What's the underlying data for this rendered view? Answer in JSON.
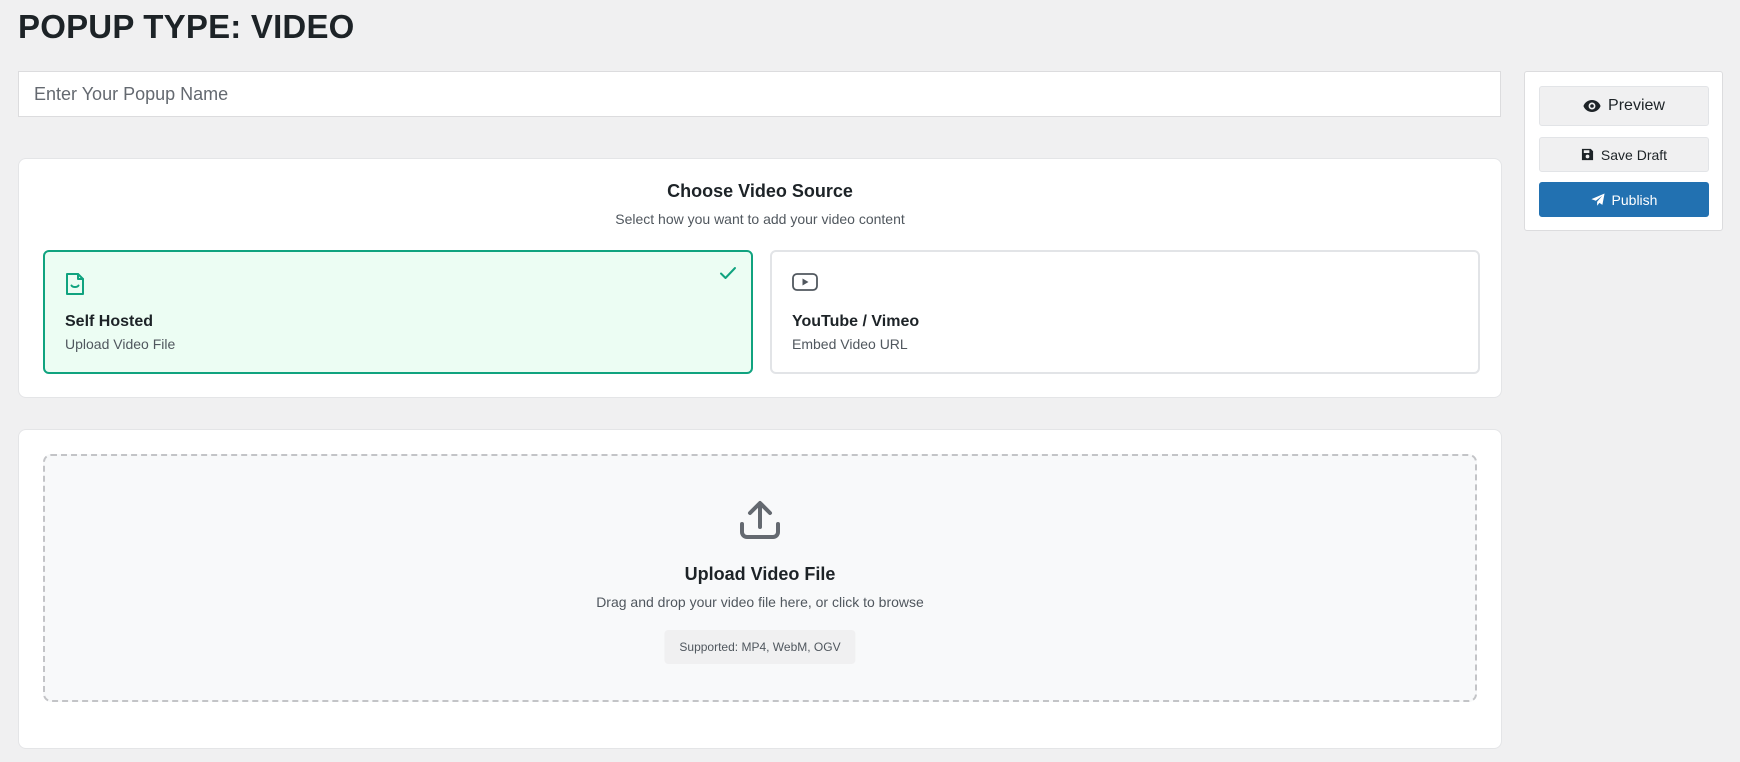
{
  "page": {
    "title": "POPUP TYPE: VIDEO"
  },
  "name_input": {
    "placeholder": "Enter Your Popup Name",
    "value": ""
  },
  "actions": {
    "preview_label": "Preview",
    "save_draft_label": "Save Draft",
    "publish_label": "Publish"
  },
  "source": {
    "title": "Choose Video Source",
    "subtitle": "Select how you want to add your video content",
    "options": [
      {
        "title": "Self Hosted",
        "description": "Upload Video File",
        "icon": "file-video-icon",
        "selected": true
      },
      {
        "title": "YouTube / Vimeo",
        "description": "Embed Video URL",
        "icon": "youtube-icon",
        "selected": false
      }
    ]
  },
  "upload": {
    "title": "Upload Video File",
    "description": "Drag and drop your video file here, or click to browse",
    "supported": "Supported: MP4, WebM, OGV",
    "icon": "upload-icon"
  },
  "colors": {
    "accent_green": "#10a37f",
    "selected_bg": "#ecfdf3",
    "primary_blue": "#2271b1",
    "page_bg": "#f0f0f1"
  }
}
